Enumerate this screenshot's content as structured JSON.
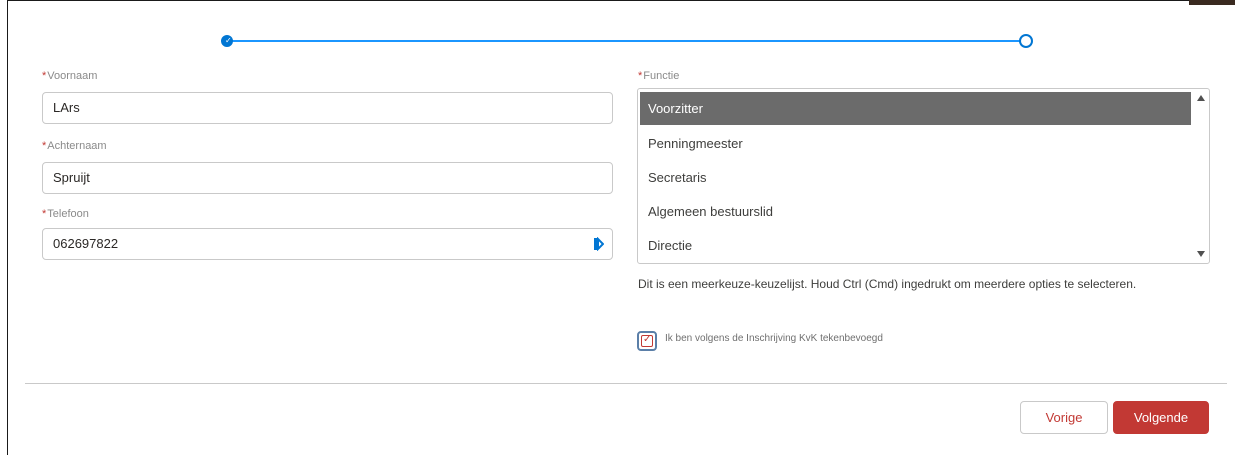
{
  "progress": {
    "steps": [
      {
        "state": "completed",
        "icon": "check-icon"
      },
      {
        "state": "current",
        "icon": "circle-icon"
      }
    ]
  },
  "form": {
    "required_marker": "*",
    "first_name": {
      "label": "Voornaam",
      "value": "LArs"
    },
    "last_name": {
      "label": "Achternaam",
      "value": "Spruijt"
    },
    "phone": {
      "label": "Telefoon",
      "value": "062697822",
      "icon": "phone-icon"
    },
    "function": {
      "label": "Functie",
      "options": [
        "Voorzitter",
        "Penningmeester",
        "Secretaris",
        "Algemeen bestuurslid",
        "Directie"
      ],
      "selected_index": 0,
      "help": "Dit is een meerkeuze-keuzelijst. Houd Ctrl (Cmd) ingedrukt om meerdere opties te selecteren."
    },
    "authorized": {
      "label": "Ik ben volgens de Inschrijving KvK tekenbevoegd",
      "checked": true
    }
  },
  "footer": {
    "prev_label": "Vorige",
    "next_label": "Volgende"
  },
  "colors": {
    "brand_blue": "#0176d3",
    "brand_red": "#c23934",
    "selected_option": "#6b6b6b"
  }
}
